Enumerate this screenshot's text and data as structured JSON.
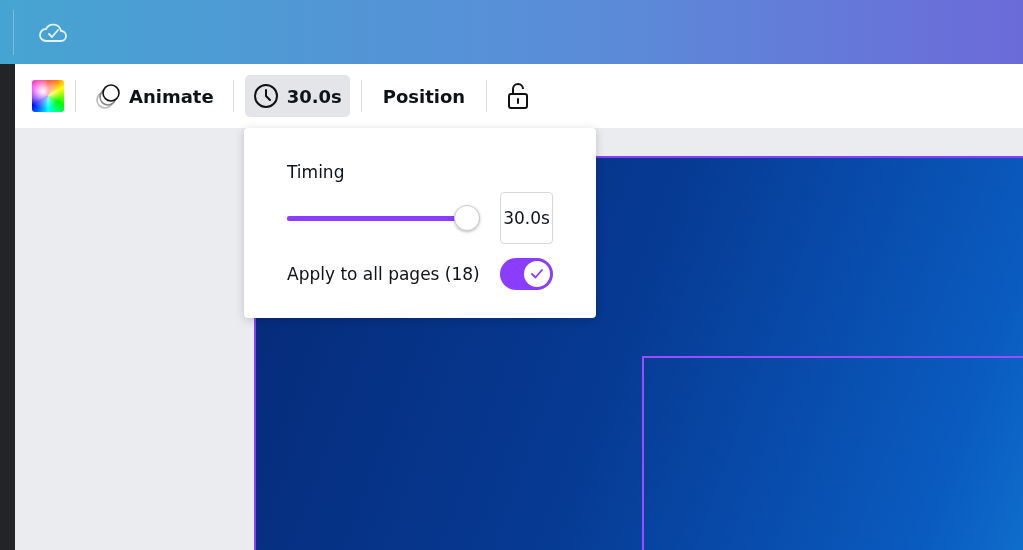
{
  "toolbar": {
    "items": [
      {
        "kind": "swatch",
        "selected": false
      },
      {
        "kind": "animate",
        "label": "Animate",
        "selected": false
      },
      {
        "kind": "timing",
        "label": "30.0s",
        "selected": true
      },
      {
        "kind": "text",
        "label": "Position",
        "selected": false
      },
      {
        "kind": "lock",
        "selected": false
      }
    ]
  },
  "timing_popover": {
    "title": "Timing",
    "slider": {
      "level": 1
    },
    "value": "30.0s",
    "toggle": {
      "label": "Apply to all pages (18)",
      "on": true
    }
  }
}
